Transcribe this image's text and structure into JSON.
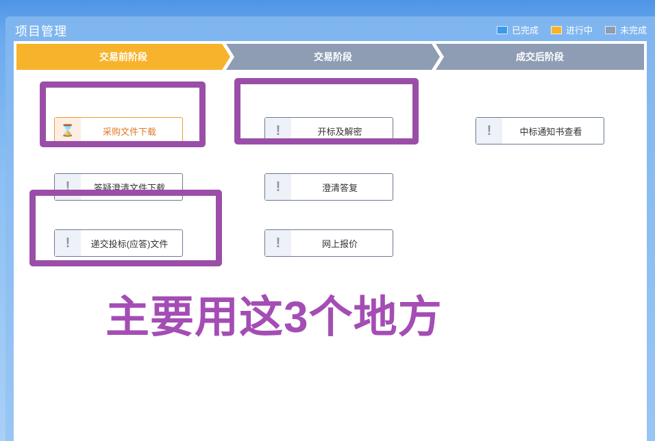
{
  "panel": {
    "title": "项目管理"
  },
  "legend": [
    {
      "label": "已完成",
      "color": "#3a9be8"
    },
    {
      "label": "进行中",
      "color": "#f7b32b"
    },
    {
      "label": "未完成",
      "color": "#8e9db4"
    }
  ],
  "stages": [
    {
      "label": "交易前阶段",
      "status": "进行中"
    },
    {
      "label": "交易阶段",
      "status": "未完成"
    },
    {
      "label": "成交后阶段",
      "status": "未完成"
    }
  ],
  "tasks": {
    "col1": [
      {
        "label": "采购文件下载",
        "icon": "hourglass-icon",
        "status": "进行中"
      },
      {
        "label": "答疑澄清文件下载",
        "icon": "exclamation-icon",
        "status": "未完成"
      },
      {
        "label": "递交投标(应答)文件",
        "icon": "exclamation-icon",
        "status": "未完成"
      }
    ],
    "col2": [
      {
        "label": "开标及解密",
        "icon": "exclamation-icon",
        "status": "未完成"
      },
      {
        "label": "澄清答复",
        "icon": "exclamation-icon",
        "status": "未完成"
      },
      {
        "label": "网上报价",
        "icon": "exclamation-icon",
        "status": "未完成"
      }
    ],
    "col3": [
      {
        "label": "中标通知书查看",
        "icon": "exclamation-icon",
        "status": "未完成"
      }
    ]
  },
  "annotation": {
    "caption": "主要用这3个地方",
    "color": "#a44db5"
  }
}
